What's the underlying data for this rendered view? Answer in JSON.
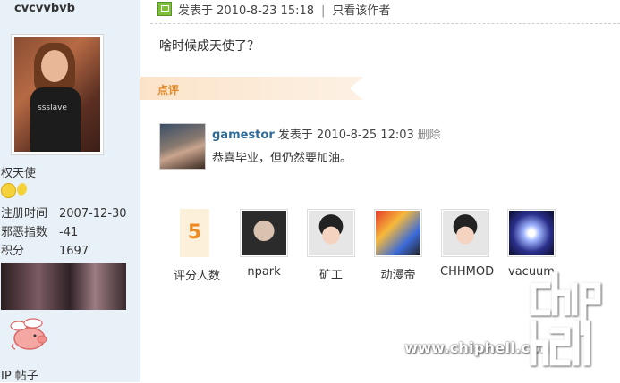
{
  "sidebar": {
    "username": "cvcvvbvb",
    "title": "权天使",
    "stats": [
      {
        "label": "注册时间",
        "value": "2007-12-30"
      },
      {
        "label": "邪恶指数",
        "value": "-41"
      },
      {
        "label": "积分",
        "value": "1697"
      }
    ],
    "bottom_text": "IP  帖子",
    "avatar_shirt_text": "ssslave"
  },
  "post": {
    "posted_at": "发表于 2010-8-23 15:18",
    "separator": "|",
    "only_author": "只看该作者",
    "body": "啥时候成天使了？"
  },
  "review": {
    "tag": "点评",
    "comment": {
      "author": "gamestor",
      "posted_at": "发表于 2010-8-25 12:03",
      "delete": "删除",
      "text": "恭喜毕业，但仍然要加油。"
    }
  },
  "ratings": {
    "count": "5",
    "count_label": "评分人数",
    "raters": [
      {
        "name": "npark",
        "icon": "npark-avatar"
      },
      {
        "name": "矿工",
        "icon": "cartoon-boy-avatar"
      },
      {
        "name": "动漫帝",
        "icon": "anime-avatar"
      },
      {
        "name": "CHHMOD",
        "icon": "cartoon-boy-avatar"
      },
      {
        "name": "vacuum",
        "icon": "light-burst-avatar"
      }
    ]
  },
  "watermark": {
    "url": "www.chiphell.com"
  }
}
